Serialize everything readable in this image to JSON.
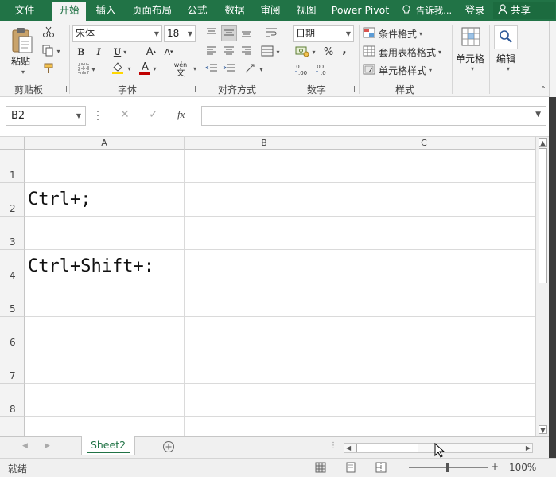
{
  "tabs": [
    "文件",
    "开始",
    "插入",
    "页面布局",
    "公式",
    "数据",
    "审阅",
    "视图",
    "Power Pivot"
  ],
  "active_tab": "开始",
  "tell_me": "告诉我...",
  "login": "登录",
  "share": "共享",
  "clipboard": {
    "paste": "粘贴",
    "group": "剪贴板"
  },
  "font": {
    "name": "宋体",
    "size": "18",
    "bold": "B",
    "italic": "I",
    "underline": "U",
    "grow": "A",
    "shrink": "A",
    "color_letter": "A",
    "wen": "wén",
    "wen_char": "文",
    "group": "字体"
  },
  "alignment": {
    "group": "对齐方式"
  },
  "number": {
    "format": "日期",
    "percent": "%",
    "comma": ",",
    "group": "数字"
  },
  "styles": {
    "conditional": "条件格式",
    "table": "套用表格格式",
    "cell": "单元格样式",
    "group": "样式"
  },
  "cells": {
    "label": "单元格"
  },
  "editing": {
    "label": "编辑"
  },
  "formula_bar": {
    "name_box": "B2",
    "fx": "fx",
    "value": ""
  },
  "columns": [
    "A",
    "B",
    "C"
  ],
  "rows": [
    "1",
    "2",
    "3",
    "4",
    "5",
    "6",
    "7",
    "8"
  ],
  "cell_values": {
    "A2": "Ctrl+;",
    "A4": "Ctrl+Shift+:"
  },
  "sheet": {
    "name": "Sheet2"
  },
  "status": {
    "ready": "就绪",
    "zoom": "100%",
    "minus": "-",
    "plus": "+"
  },
  "colors": {
    "accent": "#217346",
    "font_color": "#c00000",
    "highlight": "#ffd700"
  },
  "icons": [
    "paste-icon",
    "cut-icon",
    "copy-icon",
    "format-painter-icon",
    "fill-color-icon",
    "font-color-icon",
    "border-icon",
    "align-icon",
    "wrap-icon",
    "merge-icon",
    "currency-icon",
    "search-icon",
    "cells-icon",
    "bulb-icon",
    "user-icon",
    "add-sheet-icon"
  ]
}
